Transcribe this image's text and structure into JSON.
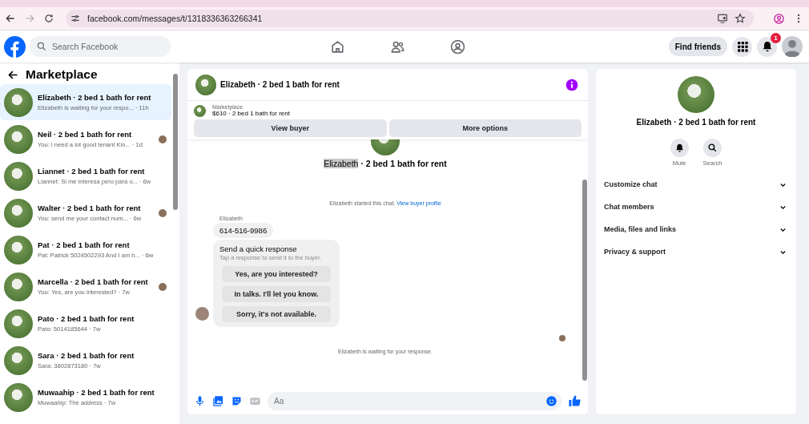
{
  "browser": {
    "url": "facebook.com/messages/t/1318336363266341"
  },
  "header": {
    "search_placeholder": "Search Facebook",
    "find_friends": "Find friends",
    "notification_count": "1"
  },
  "sidebar": {
    "title": "Marketplace",
    "items": [
      {
        "title": "Elizabeth · 2 bed 1 bath for rent",
        "preview": "Elizabeth is waiting for your respo...",
        "time": "· 11h",
        "selected": true,
        "seen": false
      },
      {
        "title": "Neil · 2 bed 1 bath for rent",
        "preview": "You: i need a lot good tenant Kin...",
        "time": "· 1d",
        "selected": false,
        "seen": true
      },
      {
        "title": "Liannet · 2 bed 1 bath for rent",
        "preview": "Liannet: Si me interesa pero para o...",
        "time": "· 6w",
        "selected": false,
        "seen": false
      },
      {
        "title": "Walter · 2 bed 1 bath for rent",
        "preview": "You: send me your contact num...",
        "time": "· 6w",
        "selected": false,
        "seen": true
      },
      {
        "title": "Pat · 2 bed 1 bath for rent",
        "preview": "Pat: Patrick 5024502293 And I am h...",
        "time": "· 6w",
        "selected": false,
        "seen": false
      },
      {
        "title": "Marcella · 2 bed 1 bath for rent",
        "preview": "You: Yes, are you interested?",
        "time": "· 7w",
        "selected": false,
        "seen": true
      },
      {
        "title": "Pato · 2 bed 1 bath for rent",
        "preview": "Pato: 5014185644",
        "time": "· 7w",
        "selected": false,
        "seen": false
      },
      {
        "title": "Sara · 2 bed 1 bath for rent",
        "preview": "Sara: 3802873180",
        "time": "· 7w",
        "selected": false,
        "seen": false
      },
      {
        "title": "Muwaahip · 2 bed 1 bath for rent",
        "preview": "Muwaahip: The address",
        "time": "· 7w",
        "selected": false,
        "seen": false
      }
    ]
  },
  "chat": {
    "title": "Elizabeth · 2 bed 1 bath for rent",
    "listing": {
      "label": "Marketplace",
      "price_title": "$610 · 2 bed 1 bath for rent"
    },
    "buttons": [
      "View buyer",
      "More options"
    ],
    "intro": {
      "name": "Elizabeth",
      "rest": "· 2 bed 1 bath for rent"
    },
    "started": {
      "text": "Elizabeth started this chat.",
      "link": "View buyer profile"
    },
    "sender": "Elizabeth",
    "message": "614-516-9986",
    "quick": {
      "title": "Send a quick response",
      "hint": "Tap a response to send it to the buyer.",
      "options": [
        "Yes, are you interested?",
        "In talks. I'll let you know.",
        "Sorry, it's not available."
      ]
    },
    "waiting": "Elizabeth is waiting for your response.",
    "composer_placeholder": "Aa"
  },
  "details": {
    "title": "Elizabeth · 2 bed 1 bath for rent",
    "actions": [
      {
        "label": "Mute",
        "kind": "bell"
      },
      {
        "label": "Search",
        "kind": "search"
      }
    ],
    "sections": [
      "Customize chat",
      "Chat members",
      "Media, files and links",
      "Privacy & support"
    ]
  }
}
